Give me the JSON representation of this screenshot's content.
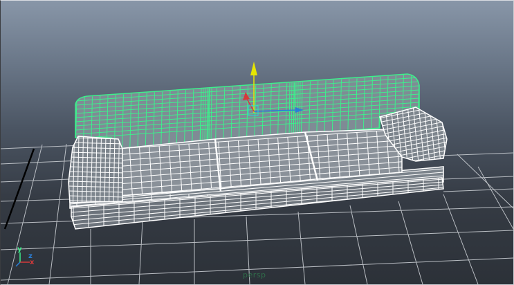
{
  "viewport": {
    "camera_name": "persp",
    "axis_labels": {
      "y": "y",
      "x": "x",
      "z": "z"
    }
  },
  "colors": {
    "selection": "#3df08c",
    "wire": "#ffffff",
    "grid": "#c9cdd2",
    "manip_y": "#e6e600",
    "manip_x": "#2a7fd6",
    "manip_z": "#d63a3a"
  }
}
